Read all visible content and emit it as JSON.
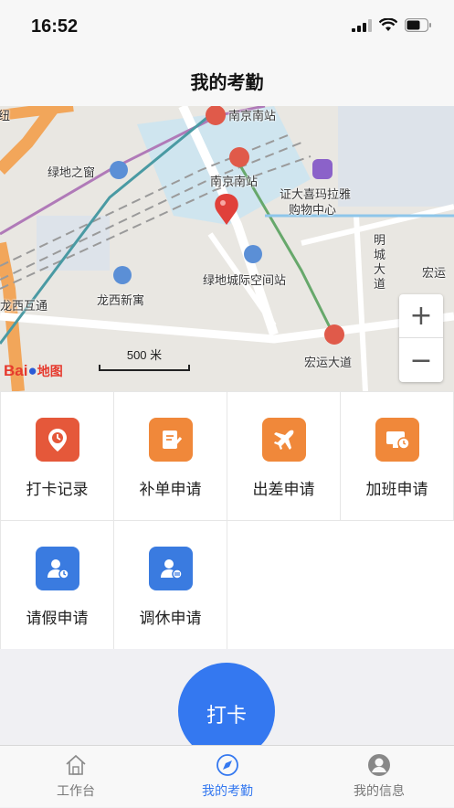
{
  "status": {
    "time": "16:52"
  },
  "nav": {
    "title": "我的考勤"
  },
  "map": {
    "labels": {
      "nanjing_south_top": "南京南站",
      "nanjing_south": "南京南站",
      "lvdi_window": "绿地之窗",
      "zhengda": "证大喜玛拉雅",
      "zhengda2": "购物中心",
      "mingcheng": "明城大道",
      "lvdi_city": "绿地城际空间站",
      "longxi": "龙西新寓",
      "longxi_interchange": "龙西互通",
      "hongyun": "宏运大道",
      "hongyun_right": "宏运",
      "niu": "纽"
    },
    "scale_text": "500 米",
    "logo_text": "Bai",
    "logo_suffix": "地图",
    "zoom_in": "+",
    "zoom_out": "−"
  },
  "menu": {
    "items": [
      {
        "label": "打卡记录",
        "icon": "location-clock-icon",
        "color": "#e5583a"
      },
      {
        "label": "补单申请",
        "icon": "edit-doc-icon",
        "color": "#f0883a"
      },
      {
        "label": "出差申请",
        "icon": "airplane-icon",
        "color": "#f0883a"
      },
      {
        "label": "加班申请",
        "icon": "monitor-clock-icon",
        "color": "#f0883a"
      },
      {
        "label": "请假申请",
        "icon": "user-clock-icon",
        "color": "#3a7be0"
      },
      {
        "label": "调休申请",
        "icon": "user-swap-icon",
        "color": "#3a7be0"
      }
    ]
  },
  "punch": {
    "label": "打卡"
  },
  "tabbar": {
    "tabs": [
      {
        "label": "工作台",
        "icon": "home-icon"
      },
      {
        "label": "我的考勤",
        "icon": "compass-icon",
        "active": true
      },
      {
        "label": "我的信息",
        "icon": "profile-icon"
      }
    ]
  }
}
